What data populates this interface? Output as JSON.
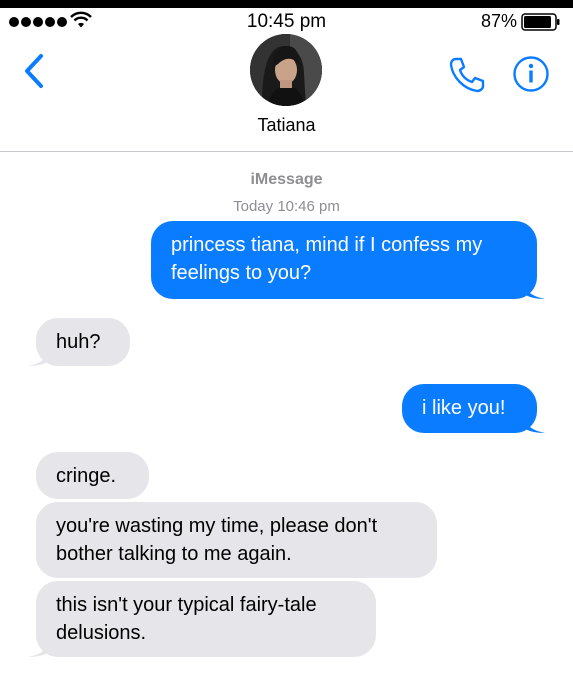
{
  "status_bar": {
    "time": "10:45 pm",
    "battery": "87%"
  },
  "header": {
    "contact_name": "Tatiana"
  },
  "thread": {
    "service": "iMessage",
    "timestamp": "Today 10:46 pm"
  },
  "messages": [
    {
      "direction": "outgoing",
      "text": "princess tiana, mind if I confess my feelings to you?"
    },
    {
      "direction": "incoming",
      "text": "huh?"
    },
    {
      "direction": "outgoing",
      "text": "i like you!"
    },
    {
      "direction": "incoming",
      "text": "cringe."
    },
    {
      "direction": "incoming",
      "text": "you're wasting my time, please don't bother talking to me again."
    },
    {
      "direction": "incoming",
      "text": "this isn't your typical fairy-tale delusions."
    }
  ],
  "colors": {
    "accent": "#0a7cff",
    "incoming_bubble": "#e5e5ea",
    "meta_text": "#8e8e93"
  },
  "icons": [
    "signal-dots-icon",
    "wifi-icon",
    "battery-icon",
    "back-chevron-icon",
    "phone-icon",
    "info-icon"
  ]
}
